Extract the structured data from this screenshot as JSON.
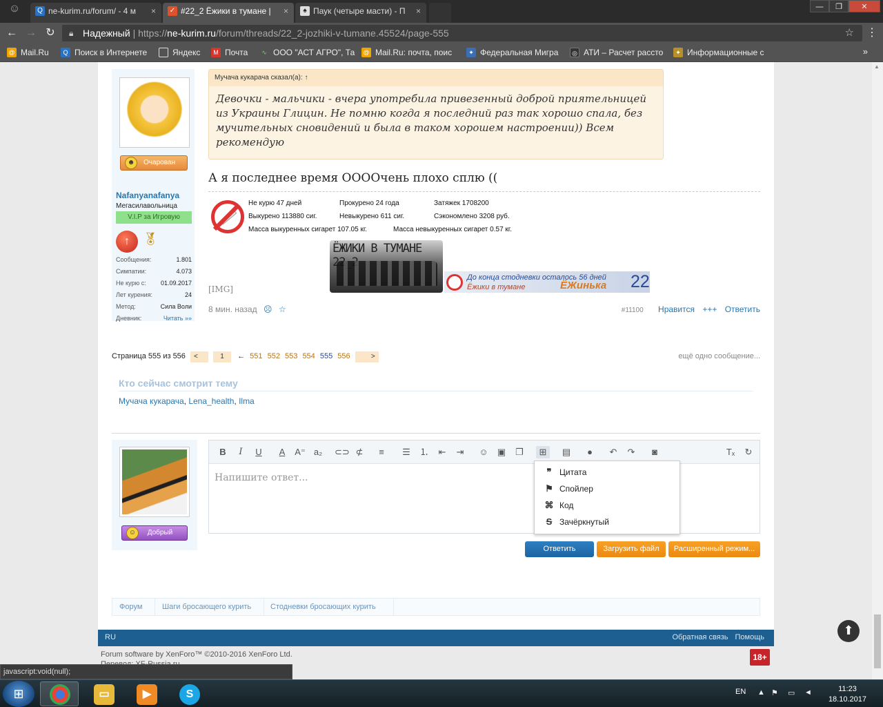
{
  "browser": {
    "tabs": [
      {
        "title": "ne-kurim.ru/forum/ - 4 м",
        "favicon": "search-icon",
        "active": false
      },
      {
        "title": "#22_2 Ёжики в тумане |",
        "favicon": "forum-icon",
        "active": true
      },
      {
        "title": "Паук (четыре масти) - П",
        "favicon": "spade-icon",
        "active": false
      }
    ],
    "address": {
      "secure_label": "Надежный",
      "url_scheme": "https://",
      "url_host": "ne-kurim.ru",
      "url_path": "/forum/threads/22_2-jozhiki-v-tumane.45524/page-555"
    },
    "bookmarks": [
      {
        "label": "Mail.Ru",
        "icon": "mailru-icon"
      },
      {
        "label": "Поиск в Интернете",
        "icon": "search-icon"
      },
      {
        "label": "Яндекс",
        "icon": "page-icon"
      },
      {
        "label": "Почта",
        "icon": "mail-icon"
      },
      {
        "label": "ООО \"АСТ АГРО\", Та",
        "icon": "link-icon"
      },
      {
        "label": "Mail.Ru: почта, поис",
        "icon": "mailru-icon"
      },
      {
        "label": "Федеральная Мигра",
        "icon": "emblem-icon"
      },
      {
        "label": "АТИ – Расчет рассто",
        "icon": "globe-icon"
      },
      {
        "label": "Информационные с",
        "icon": "emblem-icon"
      }
    ]
  },
  "post": {
    "user": {
      "mood_label": "Очарован",
      "username": "Nafanyanafanya",
      "title": "Мегасилавольница",
      "badge": "V.I.P за Игровую",
      "stats": [
        {
          "label": "Сообщения:",
          "value": "1.801"
        },
        {
          "label": "Симпатии:",
          "value": "4.073"
        },
        {
          "label": "Не курю с:",
          "value": "01.09.2017"
        },
        {
          "label": "Лет курения:",
          "value": "24"
        },
        {
          "label": "Метод:",
          "value": "Сила Воли"
        },
        {
          "label": "Дневник:",
          "value": "Читать »»"
        }
      ]
    },
    "quote": {
      "author": "Мучача кукарача сказал(а): ↑",
      "text": "Девочки - мальчики - вчера употребила привезенный доброй приятельницей из Украины Глицин. Не помню когда я последний раз так хорошо спала, без мучительных сновидений и была в таком хорошем настроении)) Всем рекомендую"
    },
    "text": "А я последнее время ООООчень плохо сплю ((",
    "signature": {
      "line1_a": "Не курю 47 дней",
      "line1_b": "Прокурено 24 года",
      "line1_c": "Затяжек 1708200",
      "line2_a": "Выкурено 113880 сиг.",
      "line2_b": "Невыкурено 611 сиг.",
      "line2_c": "Сэкономлено 3208 руб.",
      "line3_a": "Масса выкуренных сигарет 107.05 кг.",
      "line3_b": "Масса невыкуренных сигарет 0.57 кг.",
      "image_title": "ЁЖИКИ В ТУМАНЕ 22_2",
      "img_tag": "[IMG]",
      "ticker_line1": "До конца стодневки осталось 56 дней",
      "ticker_line2": "Ёжики в тумане",
      "ticker_name": "ЁЖинька",
      "ticker_number": "22"
    },
    "meta": {
      "time": "8 мин. назад",
      "post_id": "#11100",
      "like": "Нравится",
      "plus": "+++",
      "reply": "Ответить"
    }
  },
  "pagination": {
    "label": "Страница 555 из 556",
    "prev": "<",
    "first": "1",
    "arrow": "←",
    "pages": [
      "551",
      "552",
      "553",
      "554",
      "555",
      "556"
    ],
    "current": "555",
    "next": ">",
    "more": "ещё одно сообщение..."
  },
  "watching": {
    "title": "Кто сейчас смотрит тему",
    "users": [
      "Мучача кукарача",
      "Lena_health",
      "Ilma"
    ]
  },
  "reply": {
    "mood_label": "Добрый",
    "placeholder": "Напишите ответ...",
    "dropdown": [
      {
        "label": "Цитата",
        "icon": "quote-icon"
      },
      {
        "label": "Спойлер",
        "icon": "flag-icon"
      },
      {
        "label": "Код",
        "icon": "code-icon"
      },
      {
        "label": "Зачёркнутый",
        "icon": "strikethrough-icon"
      }
    ],
    "buttons": {
      "submit": "Ответить",
      "upload": "Загрузить файл",
      "advanced": "Расширенный режим..."
    }
  },
  "footer": {
    "breadcrumbs": [
      "Форум",
      "Шаги бросающего курить",
      "Стодневки бросающих курить"
    ],
    "lang": "RU",
    "feedback": "Обратная связь",
    "help": "Помощь",
    "copyright_line1": "Forum software by XenForo™ ©2010-2016 XenForo Ltd.",
    "copyright_line2": "Перевод: XF-Russia.ru",
    "age": "18+"
  },
  "status_bar": "javascript:void(null);",
  "taskbar": {
    "lang": "EN",
    "time": "11:23",
    "date": "18.10.2017"
  },
  "colors": {
    "link": "#2577b1",
    "quote_bg": "#fdf3e3",
    "footer_bar": "#1d5f91",
    "button_blue": "#1b64a4",
    "button_orange": "#ec8a10"
  }
}
